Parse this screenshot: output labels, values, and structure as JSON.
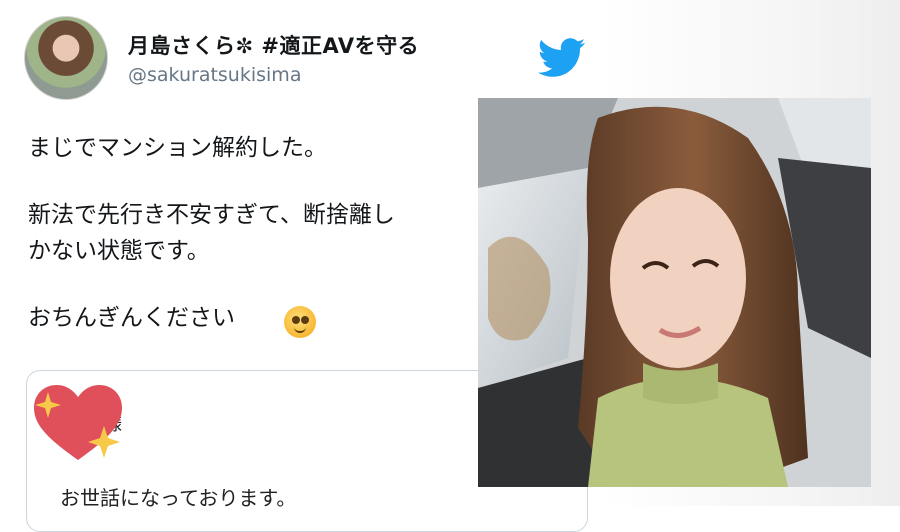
{
  "tweet": {
    "display_name": "月島さくら✼ #適正AVを守る",
    "handle": "@sakuratsukisima",
    "lines": [
      "まじでマンション解約した。",
      "新法で先行き不安すぎて、断捨離し",
      "かない状態です。",
      "おちんぎんください"
    ],
    "emoji": "pleading-face-emoji"
  },
  "quoted_card": {
    "fragment": "様",
    "text": "お世話になっております。"
  },
  "icons": {
    "brand": "twitter-bird-icon",
    "sticker": "sparkling-heart-icon"
  },
  "colors": {
    "twitter_blue": "#1da1f2",
    "handle_gray": "#657786",
    "heart_red": "#e0505a",
    "sparkle_gold": "#f7c948"
  }
}
